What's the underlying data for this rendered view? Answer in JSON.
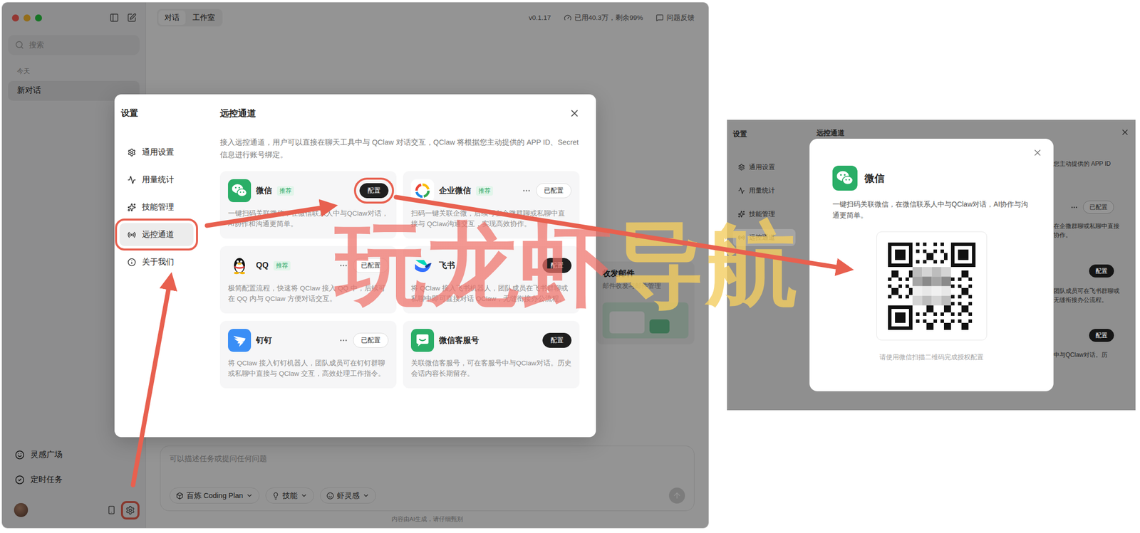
{
  "app": {
    "sidebar": {
      "search_placeholder": "搜索",
      "group_label": "今天",
      "chats": [
        {
          "title": "新对话",
          "selected": true
        }
      ],
      "footer_items": [
        "灵感广场",
        "定时任务"
      ],
      "settings_highlighted": true
    },
    "tabs": [
      {
        "label": "对话",
        "selected": true
      },
      {
        "label": "工作室",
        "selected": false
      }
    ],
    "version": "v0.1.17",
    "usage": "已用40.3万，剩余99%",
    "feedback": "问题反馈",
    "background_card": {
      "title": "收发邮件",
      "description": "邮件收发与邮件管理"
    },
    "composer": {
      "placeholder": "可以描述任务或提问任何问题",
      "chips": [
        "百炼 Coding Plan",
        "技能",
        "虾灵感"
      ],
      "disclaimer": "内容由AI生成，请仔细甄别"
    }
  },
  "settings": {
    "title": "设置",
    "nav": [
      {
        "label": "通用设置",
        "selected": false,
        "highlighted": false
      },
      {
        "label": "用量统计",
        "selected": false,
        "highlighted": false
      },
      {
        "label": "技能管理",
        "selected": false,
        "highlighted": false
      },
      {
        "label": "远控通道",
        "selected": true,
        "highlighted": true
      },
      {
        "label": "关于我们",
        "selected": false,
        "highlighted": false
      }
    ],
    "section_title": "远控通道",
    "description": "接入远控通道，用户可以直接在聊天工具中与 QClaw 对话交互，QClaw 将根据您主动提供的 APP ID、Secret 信息进行账号绑定。",
    "channels": [
      {
        "name": "微信",
        "badge": "推荐",
        "action": "配置",
        "configured": false,
        "highlighted": true,
        "description": "一键扫码关联微信，在微信联系人中与QClaw对话，AI协作和沟通更简单。"
      },
      {
        "name": "企业微信",
        "badge": "推荐",
        "action": "已配置",
        "configured": true,
        "highlighted": false,
        "description": "扫码一键关联企微，后续可在企微群聊或私聊中直接与 QClaw沟通交互，实现高效协作。"
      },
      {
        "name": "QQ",
        "badge": "推荐",
        "action": "已配置",
        "configured": true,
        "highlighted": false,
        "description": "极简配置流程，快速将 QClaw 接入 QQ 中，后续可在 QQ 内与 QClaw 方便对话交互。"
      },
      {
        "name": "飞书",
        "action": "配置",
        "configured": false,
        "highlighted": false,
        "description": "将 QClaw 接入飞书机器人，团队成员在飞书群聊或私聊中即可直接对话 QClaw，无缝衔接办公流程。"
      },
      {
        "name": "钉钉",
        "action": "已配置",
        "configured": true,
        "highlighted": false,
        "description": "将 QClaw 接入钉钉机器人，团队成员可在钉钉群聊或私聊中直接与 QClaw 交互，高效处理工作指令。"
      },
      {
        "name": "微信客服号",
        "action": "配置",
        "configured": false,
        "highlighted": false,
        "description": "关联微信客服号，可在客服号中与QClaw对话。历史会话内容长期留存。"
      }
    ]
  },
  "detail": {
    "settings_title": "设置",
    "nav": [
      {
        "label": "通用设置",
        "selected": false
      },
      {
        "label": "用量统计",
        "selected": false
      },
      {
        "label": "技能管理",
        "selected": false
      },
      {
        "label": "远控通道",
        "selected": true
      }
    ],
    "section_title": "远控通道",
    "fragments": [
      {
        "kind": "text",
        "text": "您主动提供的 APP ID"
      },
      {
        "kind": "configured",
        "text": "已配置"
      },
      {
        "kind": "text",
        "text": "在企微群聊或私聊中直接"
      },
      {
        "kind": "text",
        "text": "协作。"
      },
      {
        "kind": "button",
        "text": "配置"
      },
      {
        "kind": "text",
        "text": "团队成员可在飞书群聊或"
      },
      {
        "kind": "text",
        "text": "无缝衔接办公流程。"
      },
      {
        "kind": "button",
        "text": "配置"
      },
      {
        "kind": "text",
        "text": "中与QClaw对话。历"
      }
    ],
    "dialog": {
      "title": "微信",
      "description": "一键扫码关联微信，在微信联系人中与QClaw对话，AI协作与沟通更简单。",
      "caption": "请使用微信扫描二维码完成授权配置"
    }
  },
  "watermark": "玩龙虾导航"
}
